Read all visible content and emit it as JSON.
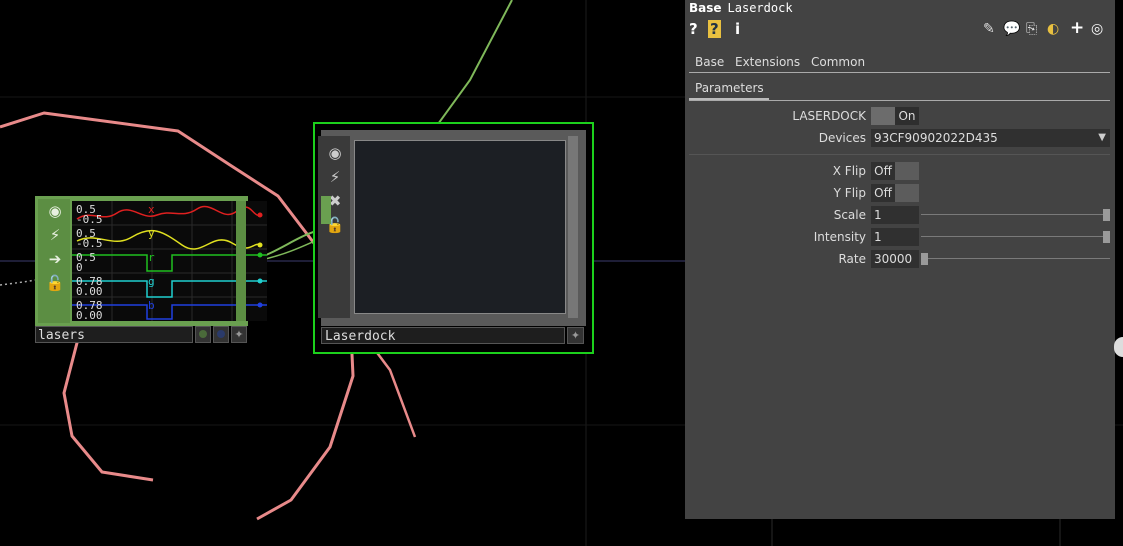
{
  "network": {
    "lasers_node": {
      "name": "lasers",
      "channels": [
        {
          "name": "x",
          "top_value": "0.5",
          "bottom_value": "-0.5",
          "color": "#e02020"
        },
        {
          "name": "y",
          "top_value": "0.5",
          "bottom_value": "-0.5",
          "color": "#e0e020"
        },
        {
          "name": "r",
          "top_value": "0.5",
          "bottom_value": "0",
          "color": "#20c020"
        },
        {
          "name": "g",
          "top_value": "0.78",
          "bottom_value": "0.00",
          "color": "#20d0d0"
        },
        {
          "name": "b",
          "top_value": "0.78",
          "bottom_value": "0.00",
          "color": "#2040e0"
        }
      ]
    },
    "laserdock_node": {
      "name": "Laserdock",
      "selected_color": "#1cd01c"
    }
  },
  "panel": {
    "op_type": "Base",
    "op_name": "Laserdock",
    "header_buttons": [
      "?",
      "?",
      "i"
    ],
    "header_icons": [
      "pencil-icon",
      "comment-icon",
      "clone-icon",
      "python-icon",
      "plus-icon",
      "target-icon"
    ],
    "tabs": [
      "Base",
      "Extensions",
      "Common"
    ],
    "active_page": "Parameters",
    "params": {
      "laserdock": {
        "label": "LASERDOCK",
        "value": "On"
      },
      "devices": {
        "label": "Devices",
        "value": "93CF90902022D435"
      },
      "xflip": {
        "label": "X Flip",
        "value": "Off"
      },
      "yflip": {
        "label": "Y Flip",
        "value": "Off"
      },
      "scale": {
        "label": "Scale",
        "value": "1",
        "level": 1.0
      },
      "intensity": {
        "label": "Intensity",
        "value": "1",
        "level": 1.0
      },
      "rate": {
        "label": "Rate",
        "value": "30000",
        "level": 0.0
      }
    }
  },
  "colors": {
    "wire_pink": "#e88a8a",
    "wire_green": "#7fb85a",
    "node_green": "#6aa050",
    "panel_bg": "#434343"
  }
}
